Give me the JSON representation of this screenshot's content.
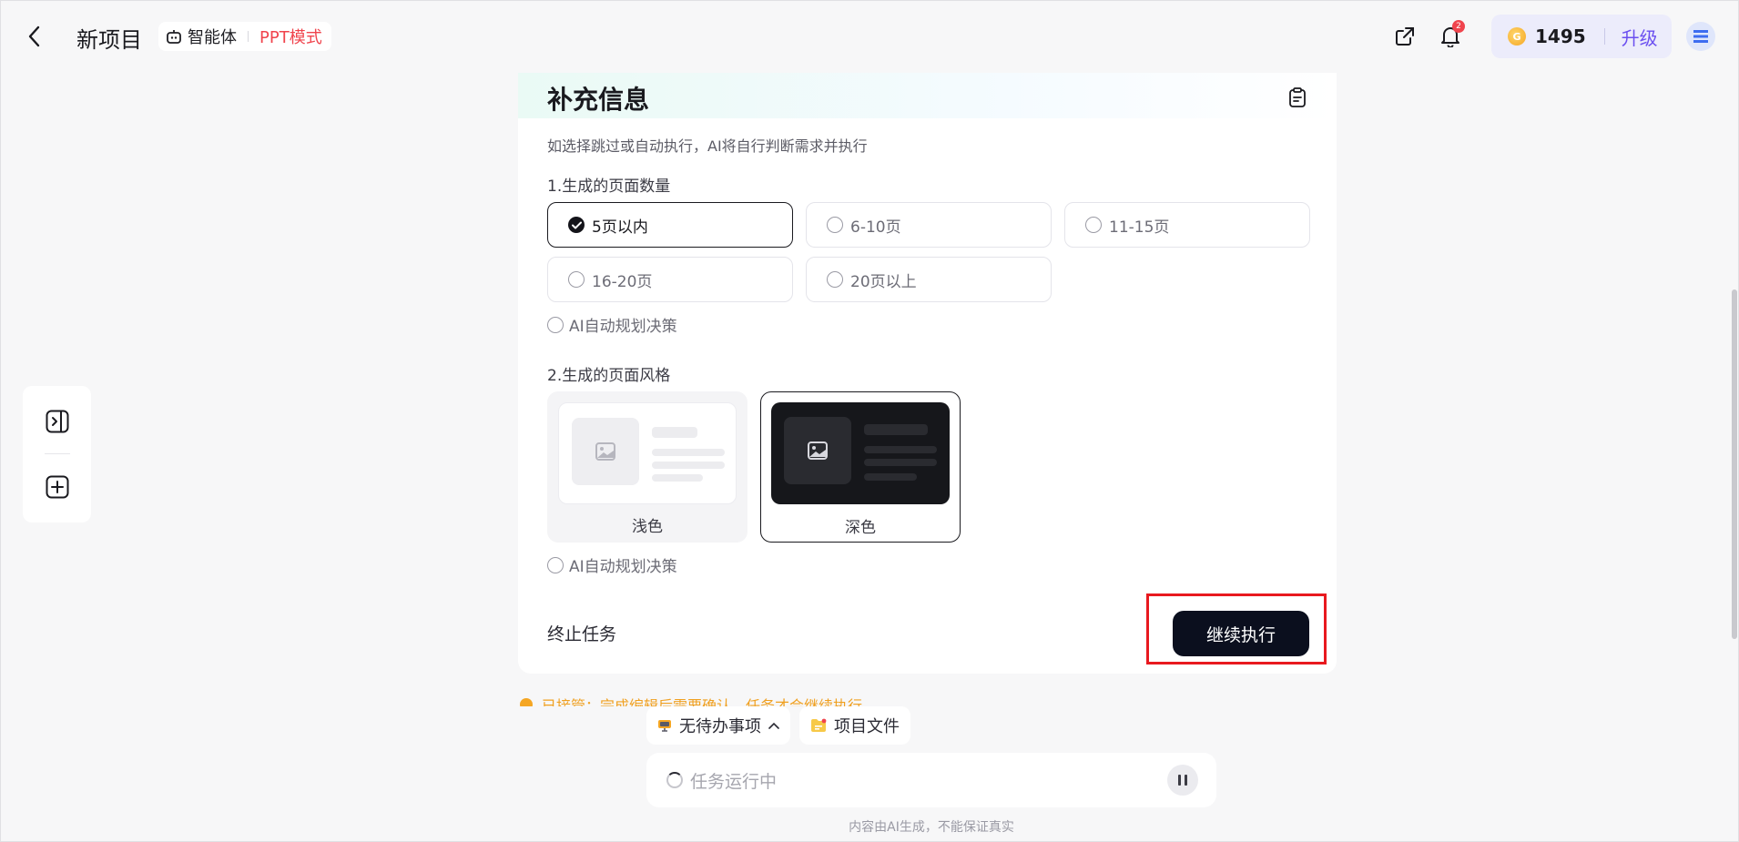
{
  "header": {
    "title": "新项目",
    "agent_label": "智能体",
    "mode_label": "PPT模式",
    "notification_count": "2",
    "credits": "1495",
    "upgrade_label": "升级"
  },
  "card": {
    "title": "补充信息",
    "hint": "如选择跳过或自动执行，AI将自行判断需求并执行",
    "question1": {
      "label": "1.生成的页面数量",
      "options": [
        "5页以内",
        "6-10页",
        "11-15页",
        "16-20页",
        "20页以上"
      ],
      "selected": "5页以内",
      "auto_label": "AI自动规划决策"
    },
    "question2": {
      "label": "2.生成的页面风格",
      "options": [
        "浅色",
        "深色"
      ],
      "selected": "深色",
      "auto_label": "AI自动规划决策"
    },
    "stop_label": "终止任务",
    "continue_label": "继续执行"
  },
  "peek_text": "已接管：完成编辑后需要确认，任务才会继续执行",
  "bottom": {
    "todo_label": "无待办事项",
    "files_label": "项目文件",
    "input_placeholder": "任务运行中",
    "disclaimer": "内容由AI生成，不能保证真实"
  },
  "colors": {
    "accent_red": "#f0444d",
    "primary_dark": "#0b0f1e",
    "upgrade_purple": "#6b4ff0",
    "highlight_box": "#e8191f"
  }
}
